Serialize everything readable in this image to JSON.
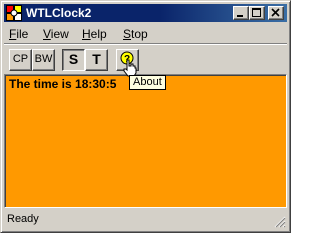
{
  "window": {
    "title": "WTLClock2"
  },
  "menu": {
    "file": "File",
    "view": "View",
    "help": "Help",
    "stop": "Stop"
  },
  "toolbar": {
    "cp_label": "CP",
    "bw_label": "BW",
    "s_label": "S",
    "t_label": "T",
    "about_icon": "question-help-icon"
  },
  "client": {
    "time_text": "The time is 18:30:5",
    "background_color": "#ff9900"
  },
  "tooltip": {
    "text": "About"
  },
  "status": {
    "text": "Ready"
  },
  "colors": {
    "titlebar": "#0a246a",
    "face": "#d4d0c8",
    "client_bg": "#ff9900",
    "tooltip_bg": "#ffffe1"
  }
}
